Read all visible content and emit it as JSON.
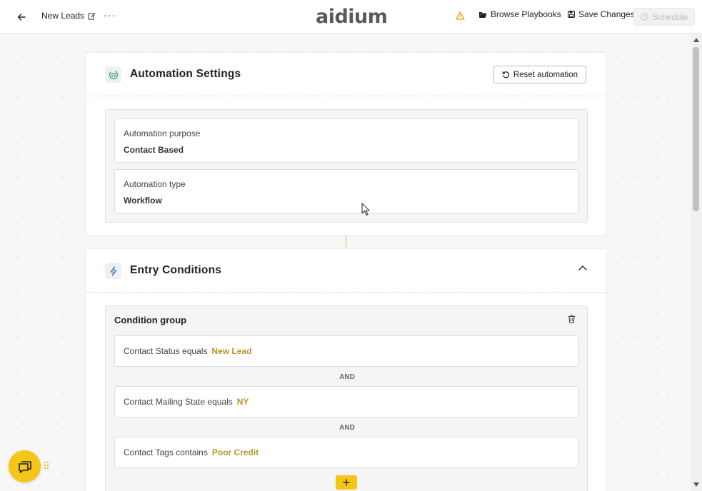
{
  "topbar": {
    "title": "New Leads",
    "more": "···",
    "logo": "aidium",
    "browse_playbooks": "Browse Playbooks",
    "save_changes": "Save Changes",
    "schedule": "Schedule"
  },
  "automation_settings": {
    "title": "Automation Settings",
    "reset_button": "Reset automation",
    "fields": [
      {
        "label": "Automation purpose",
        "value": "Contact Based"
      },
      {
        "label": "Automation type",
        "value": "Workflow"
      }
    ]
  },
  "entry_conditions": {
    "title": "Entry Conditions",
    "group_title": "Condition group",
    "conditions": [
      {
        "text": "Contact Status equals",
        "value": "New Lead"
      },
      {
        "text": "Contact Mailing State equals",
        "value": "NY"
      },
      {
        "text": "Contact Tags contains",
        "value": "Poor Credit"
      }
    ],
    "operator": "AND"
  },
  "colors": {
    "accent": "#f5c518",
    "condition_value": "#b8962b",
    "warning": "#f0a500"
  },
  "icons": {
    "back": "arrow-left-icon",
    "edit": "pencil-edit-icon",
    "warning": "warning-triangle-icon",
    "folder": "folder-open-icon",
    "save": "floppy-save-icon",
    "schedule": "clock-icon",
    "automation": "automation-icon",
    "entry": "lightning-icon",
    "reset": "reset-icon",
    "trash": "trash-icon",
    "add": "plus-icon",
    "chat": "chat-icon"
  }
}
